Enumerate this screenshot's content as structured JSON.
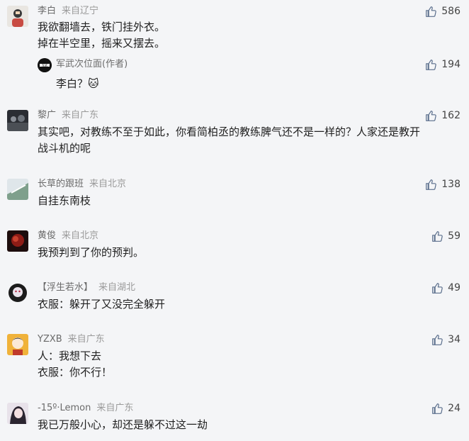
{
  "comments": [
    {
      "user": "李白",
      "location": "来自辽宁",
      "likes": "586",
      "lines": [
        "我欲翻墙去，铁门挂外衣。",
        "掉在半空里，摇来又摆去。"
      ],
      "reply": {
        "user": "军武次位面(作者)",
        "text": "李白？🐱",
        "likes": "194"
      }
    },
    {
      "user": "黎广",
      "location": "来自广东",
      "likes": "162",
      "lines": [
        "其实吧，对教练不至于如此，你看简柏丞的教练脾气还不是一样的？人家还是教开",
        "战斗机的呢"
      ]
    },
    {
      "user": "长草的跟班",
      "location": "来自北京",
      "likes": "138",
      "lines": [
        "自挂东南枝"
      ]
    },
    {
      "user": "黄俊",
      "location": "来自北京",
      "likes": "59",
      "lines": [
        "我预判到了你的预判。"
      ]
    },
    {
      "user": "【浮生若水】",
      "location": "来自湖北",
      "likes": "49",
      "lines": [
        "衣服：躲开了又没完全躲开"
      ]
    },
    {
      "user": "YZXB",
      "location": "来自广东",
      "likes": "34",
      "lines": [
        "人：我想下去",
        "衣服：你不行！"
      ]
    },
    {
      "user": "-15º·Lemon",
      "location": "来自广东",
      "likes": "24",
      "lines": [
        "我已万般小心，却还是躲不过这一劫"
      ]
    }
  ]
}
